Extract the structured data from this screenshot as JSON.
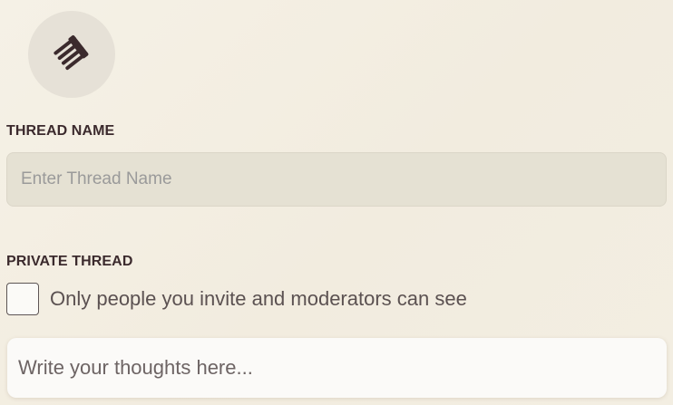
{
  "thread_icon": {
    "icon": "thread-icon",
    "background_color": "#e6e1d7",
    "icon_color": "#3b2a2d"
  },
  "thread_name": {
    "label": "THREAD NAME",
    "placeholder": "Enter Thread Name",
    "value": ""
  },
  "private_thread": {
    "label": "PRIVATE THREAD",
    "checked": false,
    "description": "Only people you invite and moderators can see"
  },
  "message": {
    "placeholder": "Write your thoughts here...",
    "value": ""
  },
  "colors": {
    "background": "#f3eee2",
    "label_text": "#3b2a2d",
    "input_background": "#e5e1d3"
  }
}
